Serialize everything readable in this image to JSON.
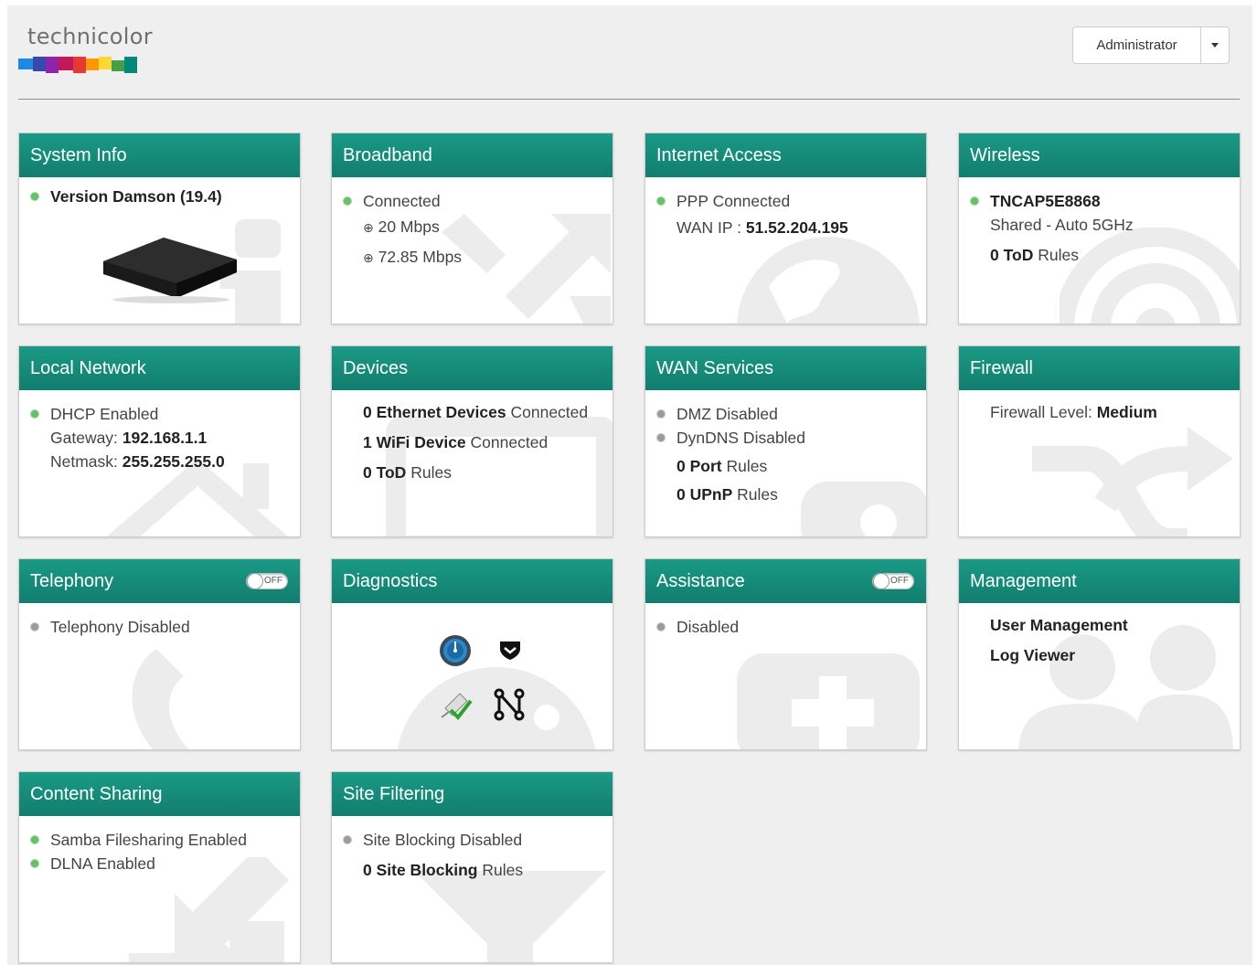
{
  "header": {
    "logo_text": "technicolor",
    "user_menu_label": "Administrator"
  },
  "colors": {
    "card_header": "#178f7d",
    "status_green": "#69c06b",
    "status_gray": "#9b9b9b",
    "page_bg": "#efefef"
  },
  "cards": {
    "system_info": {
      "title": "System Info",
      "version_label": "Version Damson (19.4)"
    },
    "broadband": {
      "title": "Broadband",
      "status": "Connected",
      "up_speed": "20 Mbps",
      "down_speed": "72.85 Mbps"
    },
    "internet_access": {
      "title": "Internet Access",
      "status": "PPP Connected",
      "wan_ip_label": "WAN IP :",
      "wan_ip": "51.52.204.195"
    },
    "wireless": {
      "title": "Wireless",
      "ssid": "TNCAP5E8868",
      "mode": "Shared - Auto 5GHz",
      "tod_count": "0",
      "tod_bold": "ToD",
      "tod_rest": "Rules"
    },
    "local_network": {
      "title": "Local Network",
      "dhcp": "DHCP Enabled",
      "gateway_label": "Gateway:",
      "gateway": "192.168.1.1",
      "netmask_label": "Netmask:",
      "netmask": "255.255.255.0"
    },
    "devices": {
      "title": "Devices",
      "eth_bold": "0 Ethernet Devices",
      "eth_rest": "Connected",
      "wifi_bold": "1 WiFi Device",
      "wifi_rest": "Connected",
      "tod_bold": "0 ToD",
      "tod_rest": "Rules"
    },
    "wan_services": {
      "title": "WAN Services",
      "dmz": "DMZ Disabled",
      "dyndns": "DynDNS Disabled",
      "port_bold": "0 Port",
      "port_rest": "Rules",
      "upnp_bold": "0 UPnP",
      "upnp_rest": "Rules"
    },
    "firewall": {
      "title": "Firewall",
      "level_label": "Firewall Level:",
      "level": "Medium"
    },
    "telephony": {
      "title": "Telephony",
      "toggle": "OFF",
      "status": "Telephony Disabled"
    },
    "diagnostics": {
      "title": "Diagnostics",
      "icons": [
        "gauge-icon",
        "pocket-icon",
        "network-check-icon",
        "graph-icon"
      ]
    },
    "assistance": {
      "title": "Assistance",
      "toggle": "OFF",
      "status": "Disabled"
    },
    "management": {
      "title": "Management",
      "user_mgmt": "User Management",
      "log_viewer": "Log Viewer"
    },
    "content_sharing": {
      "title": "Content Sharing",
      "samba": "Samba Filesharing Enabled",
      "dlna": "DLNA Enabled"
    },
    "site_filtering": {
      "title": "Site Filtering",
      "status": "Site Blocking Disabled",
      "rules_bold": "0 Site Blocking",
      "rules_rest": "Rules"
    }
  }
}
